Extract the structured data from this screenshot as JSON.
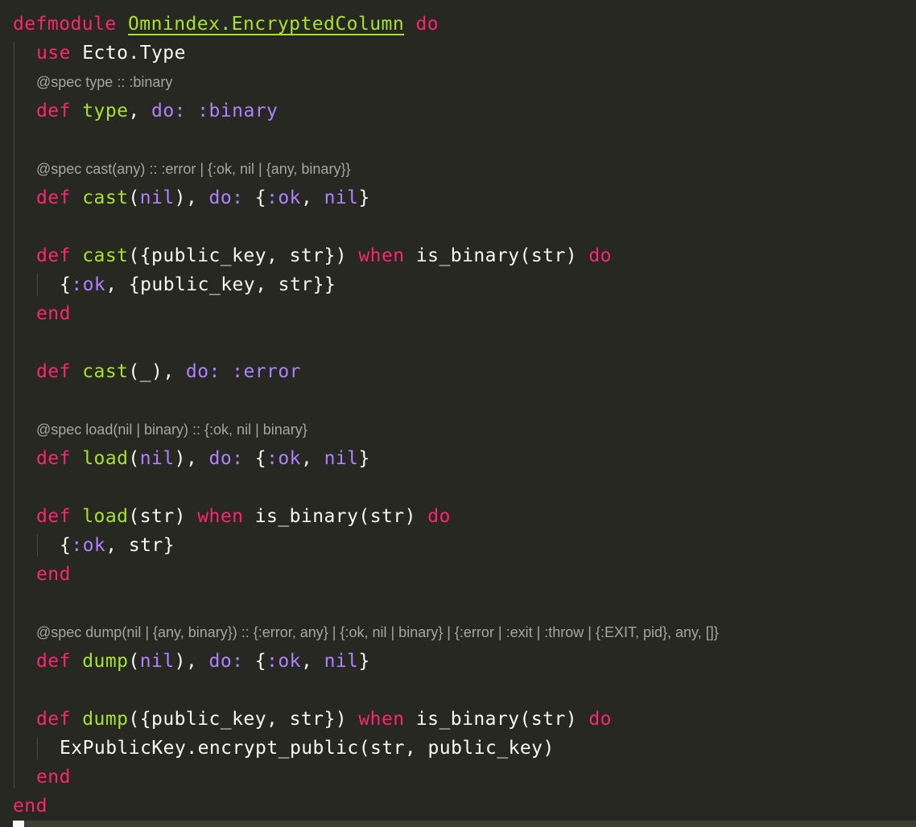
{
  "editor": {
    "language": "elixir",
    "theme_colors": {
      "background": "#272822",
      "keyword": "#f92672",
      "function": "#a6e22e",
      "atom": "#ae81ff",
      "text": "#f8f8f2",
      "inlay_hint": "#a6a69c"
    },
    "lines": [
      {
        "type": "code",
        "indent": 0,
        "tokens": [
          {
            "t": "defmodule",
            "c": "kw"
          },
          {
            "t": " ",
            "c": "plain"
          },
          {
            "t": "Omnindex.EncryptedColumn",
            "c": "modname"
          },
          {
            "t": " ",
            "c": "plain"
          },
          {
            "t": "do",
            "c": "kw"
          }
        ]
      },
      {
        "type": "code",
        "indent": 1,
        "tokens": [
          {
            "t": "use",
            "c": "kw"
          },
          {
            "t": " Ecto.Type",
            "c": "plain"
          }
        ]
      },
      {
        "type": "spec",
        "indent": 1,
        "text": "@spec type :: :binary"
      },
      {
        "type": "code",
        "indent": 1,
        "tokens": [
          {
            "t": "def",
            "c": "kw"
          },
          {
            "t": " ",
            "c": "plain"
          },
          {
            "t": "type",
            "c": "fn"
          },
          {
            "t": ", ",
            "c": "plain"
          },
          {
            "t": "do:",
            "c": "atom"
          },
          {
            "t": " ",
            "c": "plain"
          },
          {
            "t": ":binary",
            "c": "atom"
          }
        ]
      },
      {
        "type": "blank",
        "indent": 1
      },
      {
        "type": "spec",
        "indent": 1,
        "text": "@spec cast(any) :: :error | {:ok, nil | {any, binary}}"
      },
      {
        "type": "code",
        "indent": 1,
        "tokens": [
          {
            "t": "def",
            "c": "kw"
          },
          {
            "t": " ",
            "c": "plain"
          },
          {
            "t": "cast",
            "c": "fn"
          },
          {
            "t": "(",
            "c": "plain"
          },
          {
            "t": "nil",
            "c": "atom"
          },
          {
            "t": "), ",
            "c": "plain"
          },
          {
            "t": "do:",
            "c": "atom"
          },
          {
            "t": " {",
            "c": "plain"
          },
          {
            "t": ":ok",
            "c": "atom"
          },
          {
            "t": ", ",
            "c": "plain"
          },
          {
            "t": "nil",
            "c": "atom"
          },
          {
            "t": "}",
            "c": "plain"
          }
        ]
      },
      {
        "type": "blank",
        "indent": 1
      },
      {
        "type": "code",
        "indent": 1,
        "tokens": [
          {
            "t": "def",
            "c": "kw"
          },
          {
            "t": " ",
            "c": "plain"
          },
          {
            "t": "cast",
            "c": "fn"
          },
          {
            "t": "({public_key, str}) ",
            "c": "plain"
          },
          {
            "t": "when",
            "c": "kw"
          },
          {
            "t": " is_binary(str) ",
            "c": "plain"
          },
          {
            "t": "do",
            "c": "kw"
          }
        ]
      },
      {
        "type": "code",
        "indent": 2,
        "tokens": [
          {
            "t": "{",
            "c": "plain"
          },
          {
            "t": ":ok",
            "c": "atom"
          },
          {
            "t": ", {public_key, str}}",
            "c": "plain"
          }
        ]
      },
      {
        "type": "code",
        "indent": 1,
        "tokens": [
          {
            "t": "end",
            "c": "kw"
          }
        ]
      },
      {
        "type": "blank",
        "indent": 1
      },
      {
        "type": "code",
        "indent": 1,
        "tokens": [
          {
            "t": "def",
            "c": "kw"
          },
          {
            "t": " ",
            "c": "plain"
          },
          {
            "t": "cast",
            "c": "fn"
          },
          {
            "t": "(_), ",
            "c": "plain"
          },
          {
            "t": "do:",
            "c": "atom"
          },
          {
            "t": " ",
            "c": "plain"
          },
          {
            "t": ":error",
            "c": "atom"
          }
        ]
      },
      {
        "type": "blank",
        "indent": 1
      },
      {
        "type": "spec",
        "indent": 1,
        "text": "@spec load(nil | binary) :: {:ok, nil | binary}"
      },
      {
        "type": "code",
        "indent": 1,
        "tokens": [
          {
            "t": "def",
            "c": "kw"
          },
          {
            "t": " ",
            "c": "plain"
          },
          {
            "t": "load",
            "c": "fn"
          },
          {
            "t": "(",
            "c": "plain"
          },
          {
            "t": "nil",
            "c": "atom"
          },
          {
            "t": "), ",
            "c": "plain"
          },
          {
            "t": "do:",
            "c": "atom"
          },
          {
            "t": " {",
            "c": "plain"
          },
          {
            "t": ":ok",
            "c": "atom"
          },
          {
            "t": ", ",
            "c": "plain"
          },
          {
            "t": "nil",
            "c": "atom"
          },
          {
            "t": "}",
            "c": "plain"
          }
        ]
      },
      {
        "type": "blank",
        "indent": 1
      },
      {
        "type": "code",
        "indent": 1,
        "tokens": [
          {
            "t": "def",
            "c": "kw"
          },
          {
            "t": " ",
            "c": "plain"
          },
          {
            "t": "load",
            "c": "fn"
          },
          {
            "t": "(str) ",
            "c": "plain"
          },
          {
            "t": "when",
            "c": "kw"
          },
          {
            "t": " is_binary(str) ",
            "c": "plain"
          },
          {
            "t": "do",
            "c": "kw"
          }
        ]
      },
      {
        "type": "code",
        "indent": 2,
        "tokens": [
          {
            "t": "{",
            "c": "plain"
          },
          {
            "t": ":ok",
            "c": "atom"
          },
          {
            "t": ", str}",
            "c": "plain"
          }
        ]
      },
      {
        "type": "code",
        "indent": 1,
        "tokens": [
          {
            "t": "end",
            "c": "kw"
          }
        ]
      },
      {
        "type": "blank",
        "indent": 1
      },
      {
        "type": "spec",
        "indent": 1,
        "text": "@spec dump(nil | {any, binary}) :: {:error, any} | {:ok, nil | binary} | {:error | :exit | :throw | {:EXIT, pid}, any, []}"
      },
      {
        "type": "code",
        "indent": 1,
        "tokens": [
          {
            "t": "def",
            "c": "kw"
          },
          {
            "t": " ",
            "c": "plain"
          },
          {
            "t": "dump",
            "c": "fn"
          },
          {
            "t": "(",
            "c": "plain"
          },
          {
            "t": "nil",
            "c": "atom"
          },
          {
            "t": "), ",
            "c": "plain"
          },
          {
            "t": "do:",
            "c": "atom"
          },
          {
            "t": " {",
            "c": "plain"
          },
          {
            "t": ":ok",
            "c": "atom"
          },
          {
            "t": ", ",
            "c": "plain"
          },
          {
            "t": "nil",
            "c": "atom"
          },
          {
            "t": "}",
            "c": "plain"
          }
        ]
      },
      {
        "type": "blank",
        "indent": 1
      },
      {
        "type": "code",
        "indent": 1,
        "tokens": [
          {
            "t": "def",
            "c": "kw"
          },
          {
            "t": " ",
            "c": "plain"
          },
          {
            "t": "dump",
            "c": "fn"
          },
          {
            "t": "({public_key, str}) ",
            "c": "plain"
          },
          {
            "t": "when",
            "c": "kw"
          },
          {
            "t": " is_binary(str) ",
            "c": "plain"
          },
          {
            "t": "do",
            "c": "kw"
          }
        ]
      },
      {
        "type": "code",
        "indent": 2,
        "tokens": [
          {
            "t": "ExPublicKey.encrypt_public(str, public_key)",
            "c": "plain"
          }
        ]
      },
      {
        "type": "code",
        "indent": 1,
        "tokens": [
          {
            "t": "end",
            "c": "kw"
          }
        ]
      },
      {
        "type": "code",
        "indent": 0,
        "tokens": [
          {
            "t": "end",
            "c": "kw"
          }
        ]
      }
    ]
  }
}
